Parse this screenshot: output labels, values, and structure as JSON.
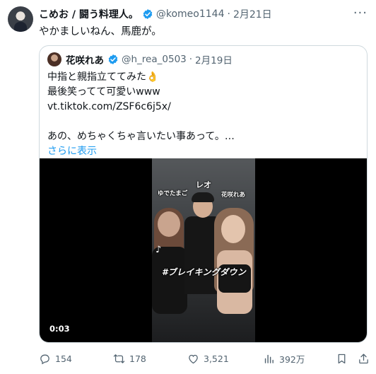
{
  "tweet": {
    "display_name": "こめお / 闘う料理人。",
    "handle": "@komeo1144",
    "separator": "·",
    "date": "2月21日",
    "text": "やかましいねん、馬鹿が。",
    "more_label": "···"
  },
  "quoted": {
    "display_name": "花咲れあ",
    "handle": "@h_rea_0503",
    "separator": "·",
    "date": "2月19日",
    "lines": [
      "中指と親指立ててみた👌",
      "最後笑ってて可愛いwww",
      "vt.tiktok.com/ZSF6c6j5x/",
      "",
      "あの、めちゃくちゃ言いたい事あって。…"
    ],
    "show_more": "さらに表示",
    "video": {
      "time": "0:03",
      "overlays": {
        "top_name": "レオ",
        "left_name": "ゆでたまご",
        "right_name": "花咲れあ",
        "hashtag": "#ブレイキングダウン"
      }
    }
  },
  "actions": {
    "replies": "154",
    "reposts": "178",
    "likes": "3,521",
    "views": "392万"
  },
  "colors": {
    "accent": "#1d9bf0",
    "secondary_text": "#536471",
    "border": "#cfd9de"
  }
}
